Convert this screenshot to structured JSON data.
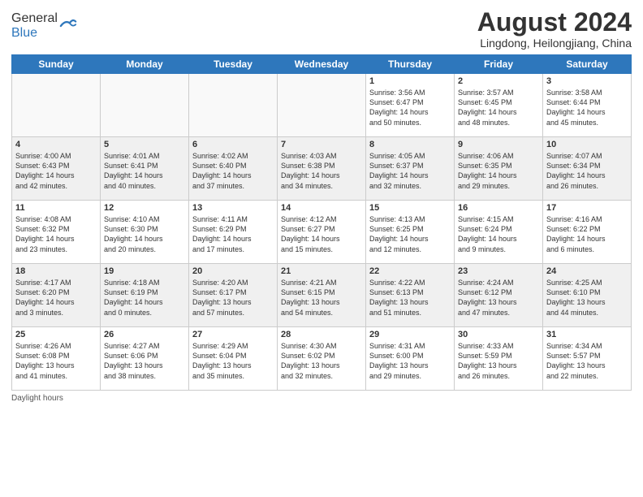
{
  "logo": {
    "general": "General",
    "blue": "Blue"
  },
  "title": {
    "month_year": "August 2024",
    "location": "Lingdong, Heilongjiang, China"
  },
  "days_of_week": [
    "Sunday",
    "Monday",
    "Tuesday",
    "Wednesday",
    "Thursday",
    "Friday",
    "Saturday"
  ],
  "weeks": [
    [
      {
        "day": "",
        "info": "",
        "empty": true
      },
      {
        "day": "",
        "info": "",
        "empty": true
      },
      {
        "day": "",
        "info": "",
        "empty": true
      },
      {
        "day": "",
        "info": "",
        "empty": true
      },
      {
        "day": "1",
        "info": "Sunrise: 3:56 AM\nSunset: 6:47 PM\nDaylight: 14 hours\nand 50 minutes."
      },
      {
        "day": "2",
        "info": "Sunrise: 3:57 AM\nSunset: 6:45 PM\nDaylight: 14 hours\nand 48 minutes."
      },
      {
        "day": "3",
        "info": "Sunrise: 3:58 AM\nSunset: 6:44 PM\nDaylight: 14 hours\nand 45 minutes."
      }
    ],
    [
      {
        "day": "4",
        "info": "Sunrise: 4:00 AM\nSunset: 6:43 PM\nDaylight: 14 hours\nand 42 minutes."
      },
      {
        "day": "5",
        "info": "Sunrise: 4:01 AM\nSunset: 6:41 PM\nDaylight: 14 hours\nand 40 minutes."
      },
      {
        "day": "6",
        "info": "Sunrise: 4:02 AM\nSunset: 6:40 PM\nDaylight: 14 hours\nand 37 minutes."
      },
      {
        "day": "7",
        "info": "Sunrise: 4:03 AM\nSunset: 6:38 PM\nDaylight: 14 hours\nand 34 minutes."
      },
      {
        "day": "8",
        "info": "Sunrise: 4:05 AM\nSunset: 6:37 PM\nDaylight: 14 hours\nand 32 minutes."
      },
      {
        "day": "9",
        "info": "Sunrise: 4:06 AM\nSunset: 6:35 PM\nDaylight: 14 hours\nand 29 minutes."
      },
      {
        "day": "10",
        "info": "Sunrise: 4:07 AM\nSunset: 6:34 PM\nDaylight: 14 hours\nand 26 minutes."
      }
    ],
    [
      {
        "day": "11",
        "info": "Sunrise: 4:08 AM\nSunset: 6:32 PM\nDaylight: 14 hours\nand 23 minutes."
      },
      {
        "day": "12",
        "info": "Sunrise: 4:10 AM\nSunset: 6:30 PM\nDaylight: 14 hours\nand 20 minutes."
      },
      {
        "day": "13",
        "info": "Sunrise: 4:11 AM\nSunset: 6:29 PM\nDaylight: 14 hours\nand 17 minutes."
      },
      {
        "day": "14",
        "info": "Sunrise: 4:12 AM\nSunset: 6:27 PM\nDaylight: 14 hours\nand 15 minutes."
      },
      {
        "day": "15",
        "info": "Sunrise: 4:13 AM\nSunset: 6:25 PM\nDaylight: 14 hours\nand 12 minutes."
      },
      {
        "day": "16",
        "info": "Sunrise: 4:15 AM\nSunset: 6:24 PM\nDaylight: 14 hours\nand 9 minutes."
      },
      {
        "day": "17",
        "info": "Sunrise: 4:16 AM\nSunset: 6:22 PM\nDaylight: 14 hours\nand 6 minutes."
      }
    ],
    [
      {
        "day": "18",
        "info": "Sunrise: 4:17 AM\nSunset: 6:20 PM\nDaylight: 14 hours\nand 3 minutes."
      },
      {
        "day": "19",
        "info": "Sunrise: 4:18 AM\nSunset: 6:19 PM\nDaylight: 14 hours\nand 0 minutes."
      },
      {
        "day": "20",
        "info": "Sunrise: 4:20 AM\nSunset: 6:17 PM\nDaylight: 13 hours\nand 57 minutes."
      },
      {
        "day": "21",
        "info": "Sunrise: 4:21 AM\nSunset: 6:15 PM\nDaylight: 13 hours\nand 54 minutes."
      },
      {
        "day": "22",
        "info": "Sunrise: 4:22 AM\nSunset: 6:13 PM\nDaylight: 13 hours\nand 51 minutes."
      },
      {
        "day": "23",
        "info": "Sunrise: 4:24 AM\nSunset: 6:12 PM\nDaylight: 13 hours\nand 47 minutes."
      },
      {
        "day": "24",
        "info": "Sunrise: 4:25 AM\nSunset: 6:10 PM\nDaylight: 13 hours\nand 44 minutes."
      }
    ],
    [
      {
        "day": "25",
        "info": "Sunrise: 4:26 AM\nSunset: 6:08 PM\nDaylight: 13 hours\nand 41 minutes."
      },
      {
        "day": "26",
        "info": "Sunrise: 4:27 AM\nSunset: 6:06 PM\nDaylight: 13 hours\nand 38 minutes."
      },
      {
        "day": "27",
        "info": "Sunrise: 4:29 AM\nSunset: 6:04 PM\nDaylight: 13 hours\nand 35 minutes."
      },
      {
        "day": "28",
        "info": "Sunrise: 4:30 AM\nSunset: 6:02 PM\nDaylight: 13 hours\nand 32 minutes."
      },
      {
        "day": "29",
        "info": "Sunrise: 4:31 AM\nSunset: 6:00 PM\nDaylight: 13 hours\nand 29 minutes."
      },
      {
        "day": "30",
        "info": "Sunrise: 4:33 AM\nSunset: 5:59 PM\nDaylight: 13 hours\nand 26 minutes."
      },
      {
        "day": "31",
        "info": "Sunrise: 4:34 AM\nSunset: 5:57 PM\nDaylight: 13 hours\nand 22 minutes."
      }
    ]
  ],
  "footer": {
    "daylight_label": "Daylight hours"
  }
}
